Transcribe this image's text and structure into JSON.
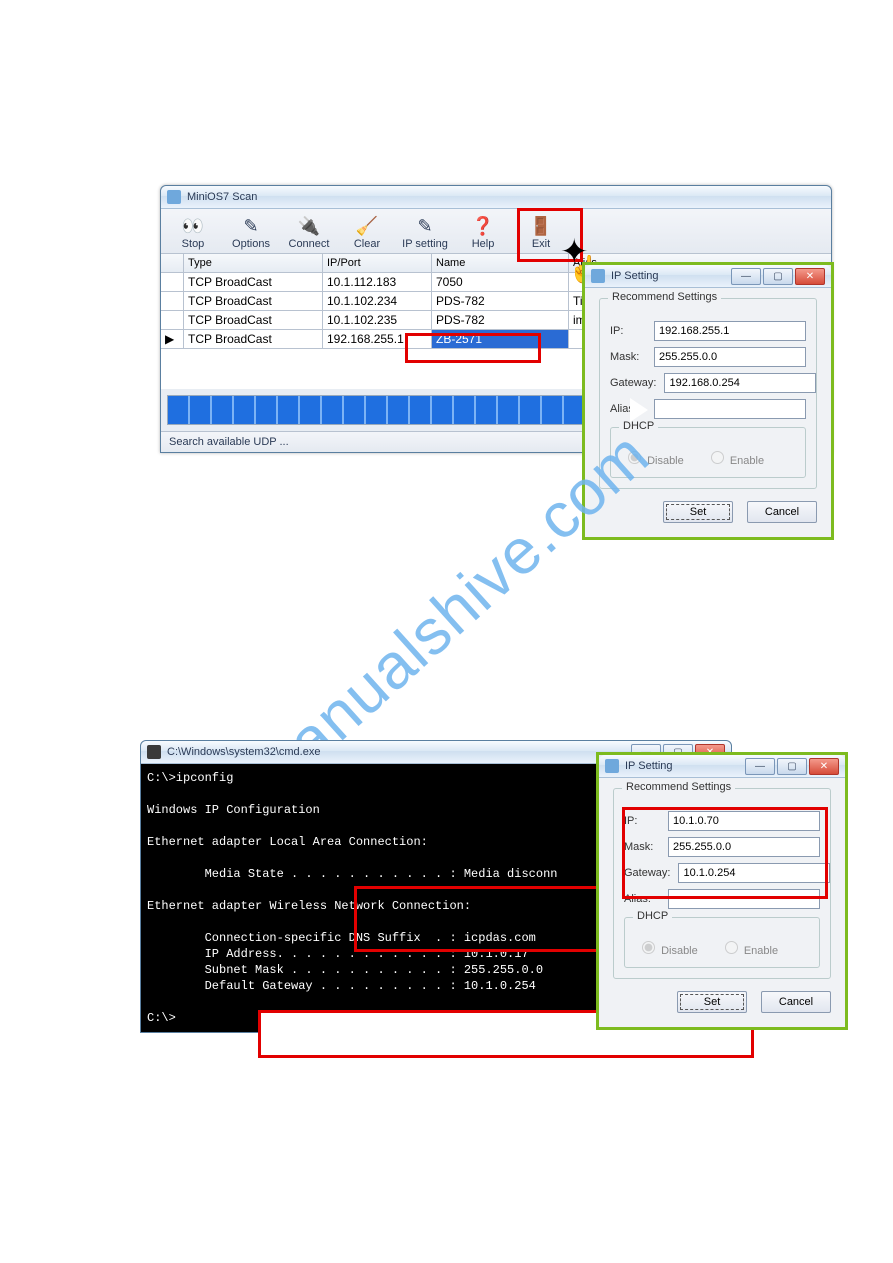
{
  "minios": {
    "title": "MiniOS7 Scan",
    "toolbar": [
      {
        "key": "stop",
        "label": "Stop",
        "glyph": "👀"
      },
      {
        "key": "options",
        "label": "Options",
        "glyph": "✎"
      },
      {
        "key": "connect",
        "label": "Connect",
        "glyph": "🔌"
      },
      {
        "key": "clear",
        "label": "Clear",
        "glyph": "🧹"
      },
      {
        "key": "ipsetting",
        "label": "IP setting",
        "glyph": "✎"
      },
      {
        "key": "help",
        "label": "Help",
        "glyph": "❓"
      },
      {
        "key": "exit",
        "label": "Exit",
        "glyph": "🚪"
      }
    ],
    "headers": {
      "type": "Type",
      "ip": "IP/Port",
      "name": "Name",
      "alias": "Alias"
    },
    "rows": [
      {
        "type": "TCP BroadCast",
        "ip": "10.1.112.183",
        "name": "7050",
        "alias": ""
      },
      {
        "type": "TCP BroadCast",
        "ip": "10.1.102.234",
        "name": "PDS-782",
        "alias": "Tim782-0"
      },
      {
        "type": "TCP BroadCast",
        "ip": "10.1.102.235",
        "name": "PDS-782",
        "alias": "im782-1"
      },
      {
        "type": "TCP BroadCast",
        "ip": "192.168.255.1",
        "name": "ZB-2571",
        "alias": ""
      }
    ],
    "status": "Search available UDP ..."
  },
  "ipset1": {
    "title": "IP Setting",
    "group_title": "Recommend Settings",
    "labels": {
      "ip": "IP:",
      "mask": "Mask:",
      "gw": "Gateway:",
      "alias": "Alias:"
    },
    "values": {
      "ip": "192.168.255.1",
      "mask": "255.255.0.0",
      "gw": "192.168.0.254",
      "alias": ""
    },
    "dhcp": {
      "title": "DHCP",
      "disable": "Disable",
      "enable": "Enable"
    },
    "buttons": {
      "set": "Set",
      "cancel": "Cancel"
    }
  },
  "cmd": {
    "title": "C:\\Windows\\system32\\cmd.exe",
    "text": "C:\\>ipconfig\n\nWindows IP Configuration\n\nEthernet adapter Local Area Connection:\n\n        Media State . . . . . . . . . . . : Media disconn\n\nEthernet adapter Wireless Network Connection:\n\n        Connection-specific DNS Suffix  . : icpdas.com\n        IP Address. . . . . . . . . . . . : 10.1.0.17\n        Subnet Mask . . . . . . . . . . . : 255.255.0.0\n        Default Gateway . . . . . . . . . : 10.1.0.254\n\nC:\\>"
  },
  "ipset2": {
    "title": "IP Setting",
    "group_title": "Recommend Settings",
    "labels": {
      "ip": "IP:",
      "mask": "Mask:",
      "gw": "Gateway:",
      "alias": "Alias:"
    },
    "values": {
      "ip": "10.1.0.70",
      "mask": "255.255.0.0",
      "gw": "10.1.0.254",
      "alias": ""
    },
    "dhcp": {
      "title": "DHCP",
      "disable": "Disable",
      "enable": "Enable"
    },
    "buttons": {
      "set": "Set",
      "cancel": "Cancel"
    }
  },
  "watermark": "manualshive.com"
}
